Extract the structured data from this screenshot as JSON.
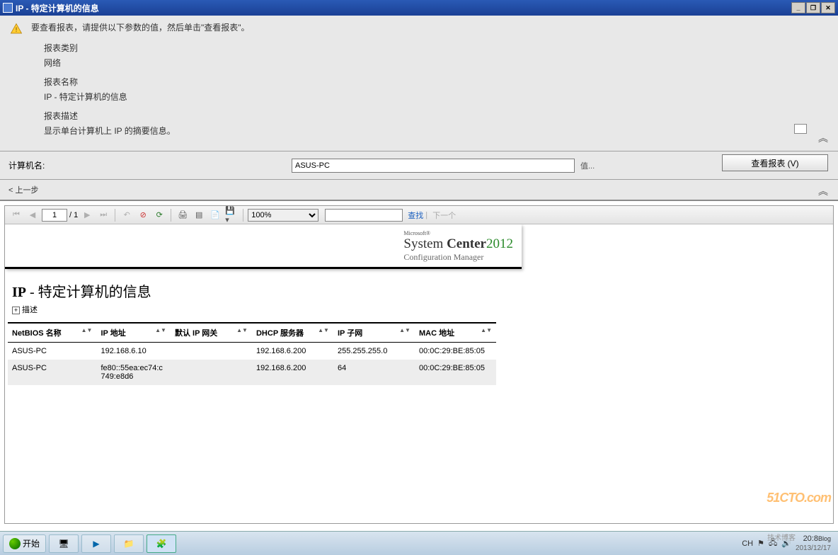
{
  "window": {
    "title": "IP - 特定计算机的信息"
  },
  "info": {
    "message": "要查看报表，请提供以下参数的值，然后单击\"查看报表\"。",
    "cat_label": "报表类别",
    "cat_value": "网络",
    "name_label": "报表名称",
    "name_value": "IP - 特定计算机的信息",
    "desc_label": "报表描述",
    "desc_value": "显示单台计算机上 IP 的摘要信息。"
  },
  "params": {
    "label": "计算机名:",
    "value": "ASUS-PC",
    "value_btn": "值...",
    "view_btn": "查看报表 (V)"
  },
  "back": {
    "label": "< 上一步"
  },
  "toolbar": {
    "page": "1",
    "page_of": "/ 1",
    "zoom": "100%",
    "find": "查找",
    "next": "下一个"
  },
  "banner": {
    "ms": "Microsoft®",
    "p1": "System",
    "p2": "Center",
    "year": "2012",
    "sub": "Configuration Manager"
  },
  "report": {
    "title_tag": "IP",
    "title_rest": " - 特定计算机的信息",
    "desc_toggle": "描述"
  },
  "table": {
    "cols": [
      "NetBIOS 名称",
      "IP 地址",
      "默认 IP 网关",
      "DHCP 服务器",
      "IP 子网",
      "MAC 地址"
    ],
    "rows": [
      {
        "c": [
          "ASUS-PC",
          "192.168.6.10",
          "",
          "192.168.6.200",
          "255.255.255.0",
          "00:0C:29:BE:85:05"
        ]
      },
      {
        "c": [
          "ASUS-PC",
          "fe80::55ea:ec74:c749:e8d6",
          "",
          "192.168.6.200",
          "64",
          "00:0C:29:BE:85:05"
        ]
      }
    ]
  },
  "taskbar": {
    "start": "开始",
    "tray_ch": "CH",
    "time": "20:8",
    "date": "2013/12/17",
    "watermark": "51CTO.com",
    "wm_sub": "技术博客",
    "blog": "Blog"
  }
}
